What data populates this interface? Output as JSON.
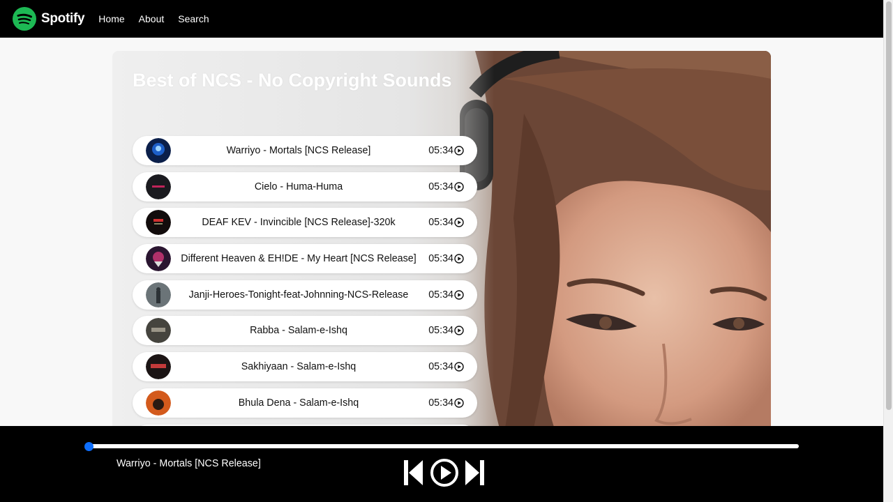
{
  "navbar": {
    "brand": "Spotify",
    "brand_color": "#1DB954",
    "logo_icon": "spotify-logo-icon",
    "links": [
      {
        "label": "Home"
      },
      {
        "label": "About"
      },
      {
        "label": "Search"
      }
    ]
  },
  "playlist": {
    "title": "Best of NCS - No Copyright Sounds",
    "songs": [
      {
        "name": "Warriyo - Mortals [NCS Release]",
        "duration": "05:34",
        "icon": "play-circle-icon"
      },
      {
        "name": "Cielo - Huma-Huma",
        "duration": "05:34",
        "icon": "play-circle-icon"
      },
      {
        "name": "DEAF KEV - Invincible [NCS Release]-320k",
        "duration": "05:34",
        "icon": "play-circle-icon"
      },
      {
        "name": "Different Heaven & EH!DE - My Heart [NCS Release]",
        "duration": "05:34",
        "icon": "play-circle-icon"
      },
      {
        "name": "Janji-Heroes-Tonight-feat-Johnning-NCS-Release",
        "duration": "05:34",
        "icon": "play-circle-icon"
      },
      {
        "name": "Rabba - Salam-e-Ishq",
        "duration": "05:34",
        "icon": "play-circle-icon"
      },
      {
        "name": "Sakhiyaan - Salam-e-Ishq",
        "duration": "05:34",
        "icon": "play-circle-icon"
      },
      {
        "name": "Bhula Dena - Salam-e-Ishq",
        "duration": "05:34",
        "icon": "play-circle-icon"
      }
    ]
  },
  "player": {
    "now_playing": "Warriyo - Mortals [NCS Release]",
    "progress": 0,
    "progress_color": "#0d6efd",
    "controls": [
      "previous-icon",
      "play-circle-icon",
      "next-icon"
    ]
  }
}
